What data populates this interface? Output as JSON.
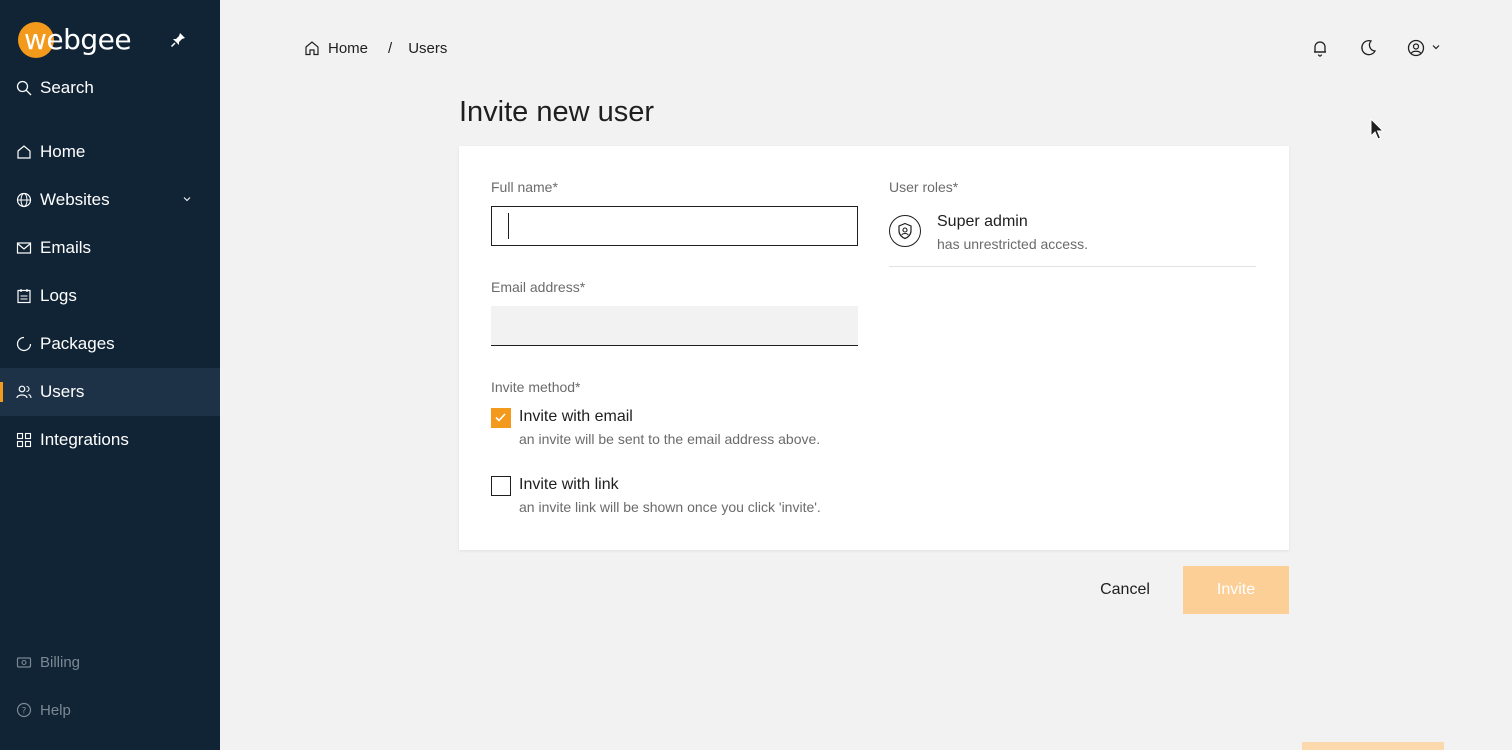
{
  "sidebar": {
    "logo_text": "webgee",
    "search_label": "Search",
    "items": [
      {
        "label": "Home"
      },
      {
        "label": "Websites"
      },
      {
        "label": "Emails"
      },
      {
        "label": "Logs"
      },
      {
        "label": "Packages"
      },
      {
        "label": "Users"
      },
      {
        "label": "Integrations"
      }
    ],
    "bottom": [
      {
        "label": "Billing"
      },
      {
        "label": "Help"
      }
    ],
    "active_item": "Users"
  },
  "breadcrumb": {
    "home": "Home",
    "separator": "/",
    "current": "Users"
  },
  "page": {
    "title": "Invite new user"
  },
  "form": {
    "full_name_label": "Full name*",
    "full_name_value": "",
    "email_label": "Email address*",
    "email_value": "",
    "invite_method_label": "Invite method*",
    "invite_email_title": "Invite with email",
    "invite_email_sub": "an invite will be sent to the email address above.",
    "invite_email_checked": true,
    "invite_link_title": "Invite with link",
    "invite_link_sub": "an invite link will be shown once you click 'invite'.",
    "invite_link_checked": false,
    "user_roles_label": "User roles*",
    "role_title": "Super admin",
    "role_sub": "has unrestricted access."
  },
  "actions": {
    "cancel_label": "Cancel",
    "invite_label": "Invite"
  },
  "colors": {
    "accent": "#f39a1c",
    "sidebar_bg": "#112436",
    "invite_disabled": "#fbcf96"
  }
}
